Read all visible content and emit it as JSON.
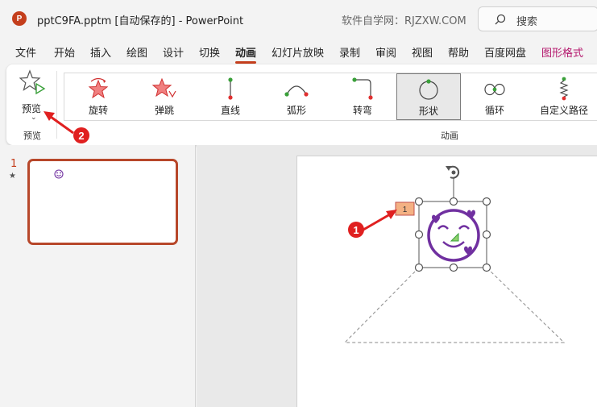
{
  "titlebar": {
    "logo_letter": "P",
    "title": "pptC9FA.pptm [自动保存的]  -  PowerPoint",
    "watermark": "软件自学网：RJZXW.COM",
    "search_placeholder": "搜索"
  },
  "menu": {
    "items": [
      "文件",
      "开始",
      "插入",
      "绘图",
      "设计",
      "切换",
      "动画",
      "幻灯片放映",
      "录制",
      "审阅",
      "视图",
      "帮助",
      "百度网盘",
      "图形格式"
    ],
    "active": "动画",
    "accent": "图形格式"
  },
  "ribbon": {
    "preview_label": "预览",
    "preview_caret": "⌄",
    "preview_group_label": "预览",
    "animation_group_label": "动画",
    "animations": [
      {
        "label": "旋转",
        "icon": "spin-icon",
        "selected": false
      },
      {
        "label": "弹跳",
        "icon": "bounce-icon",
        "selected": false
      },
      {
        "label": "直线",
        "icon": "line-path-icon",
        "selected": false
      },
      {
        "label": "弧形",
        "icon": "arc-path-icon",
        "selected": false
      },
      {
        "label": "转弯",
        "icon": "turn-path-icon",
        "selected": false
      },
      {
        "label": "形状",
        "icon": "shape-path-icon",
        "selected": true
      },
      {
        "label": "循环",
        "icon": "loop-path-icon",
        "selected": false
      },
      {
        "label": "自定义路径",
        "icon": "custom-path-icon",
        "selected": false
      }
    ]
  },
  "slides_panel": {
    "slide_number": "1",
    "animation_marker": "★"
  },
  "canvas": {
    "animation_order_tag": "1"
  },
  "callouts": [
    {
      "number": "1"
    },
    {
      "number": "2"
    }
  ],
  "colors": {
    "accent": "#c43e1c",
    "purple": "#7030a0",
    "callout_red": "#e02020",
    "tag_fill": "#f4b183"
  }
}
